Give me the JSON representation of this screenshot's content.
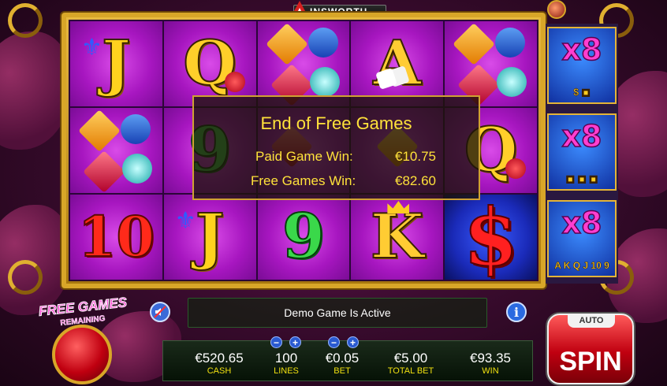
{
  "header": {
    "brand": "INSWORTH"
  },
  "reels": [
    [
      "J",
      "gems",
      "10"
    ],
    [
      "Q",
      "9",
      "J"
    ],
    [
      "gems",
      "gems",
      "9"
    ],
    [
      "A",
      "gems",
      "K"
    ],
    [
      "gems",
      "Q",
      "$"
    ]
  ],
  "dialog": {
    "title": "End of Free Games",
    "paid_label": "Paid Game Win:",
    "paid_value": "€10.75",
    "free_label": "Free Games Win:",
    "free_value": "€82.60"
  },
  "side_panels": [
    {
      "multiplier": "x8",
      "subtitle": "$ ▣"
    },
    {
      "multiplier": "x8",
      "subtitle": "▣ ▣ ▣"
    },
    {
      "multiplier": "x8",
      "subtitle": "A K Q J 10 9"
    }
  ],
  "free_games": {
    "label": "FREE GAMES",
    "sub": "REMAINING"
  },
  "status": {
    "message": "Demo Game Is Active"
  },
  "meters": [
    {
      "value": "€520.65",
      "label": "CASH"
    },
    {
      "value": "100",
      "label": "LINES"
    },
    {
      "value": "€0.05",
      "label": "BET"
    },
    {
      "value": "€5.00",
      "label": "TOTAL BET"
    },
    {
      "value": "€93.35",
      "label": "WIN"
    }
  ],
  "controls": {
    "minus": "−",
    "plus": "+",
    "auto": "AUTO",
    "spin": "SPIN",
    "info": "i"
  },
  "colors": {
    "reel_bg": "#a716c0",
    "frame_gold": "#d8a628",
    "dialog_text": "#ffe23a",
    "meter_label": "#f0e010",
    "spin_red": "#c00010"
  }
}
